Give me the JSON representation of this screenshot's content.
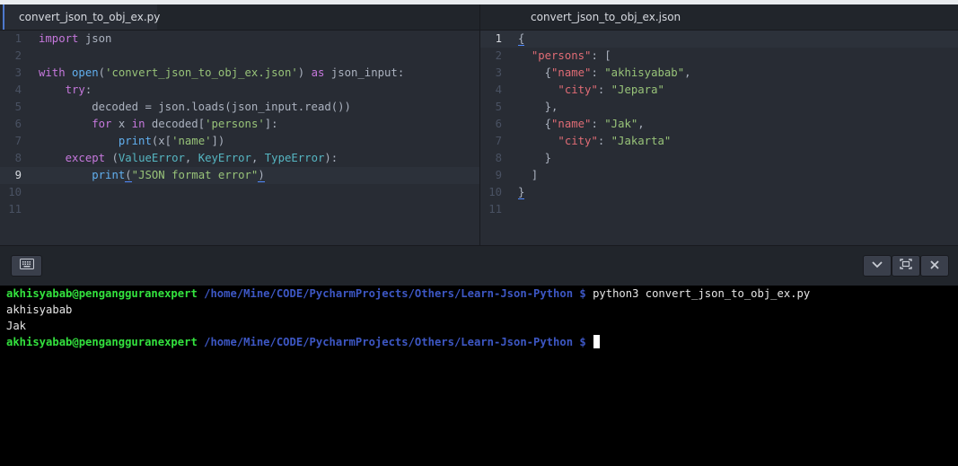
{
  "tabs": {
    "left": "convert_json_to_obj_ex.py",
    "right": "convert_json_to_obj_ex.json"
  },
  "editor_py": {
    "line_numbers": [
      "1",
      "2",
      "3",
      "4",
      "5",
      "6",
      "7",
      "8",
      "9",
      "10",
      "11"
    ],
    "current_line": "9",
    "lines": [
      "import json",
      "",
      "with open('convert_json_to_obj_ex.json') as json_input:",
      "    try:",
      "        decoded = json.loads(json_input.read())",
      "        for x in decoded['persons']:",
      "            print(x['name'])",
      "    except (ValueError, KeyError, TypeError):",
      "        print(\"JSON format error\")",
      "",
      ""
    ]
  },
  "editor_json": {
    "line_numbers": [
      "1",
      "2",
      "3",
      "4",
      "5",
      "6",
      "7",
      "8",
      "9",
      "10",
      "11"
    ],
    "current_line": "1",
    "lines": [
      "{",
      "  \"persons\": [",
      "    {\"name\": \"akhisyabab\",",
      "      \"city\": \"Jepara\"",
      "    },",
      "    {\"name\": \"Jak\",",
      "      \"city\": \"Jakarta\"",
      "    }",
      "  ]",
      "}",
      ""
    ]
  },
  "toolbar": {
    "keyboard_icon": "keyboard-icon",
    "minimize_icon": "chevron-down-icon",
    "maximize_icon": "maximize-icon",
    "close_icon": "close-icon"
  },
  "terminal": {
    "user_host": "akhisyabab@pengangguranexpert",
    "path": " /home/Mine/CODE/PycharmProjects/Others/Learn-Json-Python",
    "prompt": " $ ",
    "command": "python3 convert_json_to_obj_ex.py",
    "output": [
      "akhisyabab",
      "Jak"
    ]
  },
  "colors": {
    "editor_bg": "#282c34",
    "terminal_bg": "#000000",
    "prompt_user": "#33e23e",
    "prompt_path": "#3d57c4"
  }
}
